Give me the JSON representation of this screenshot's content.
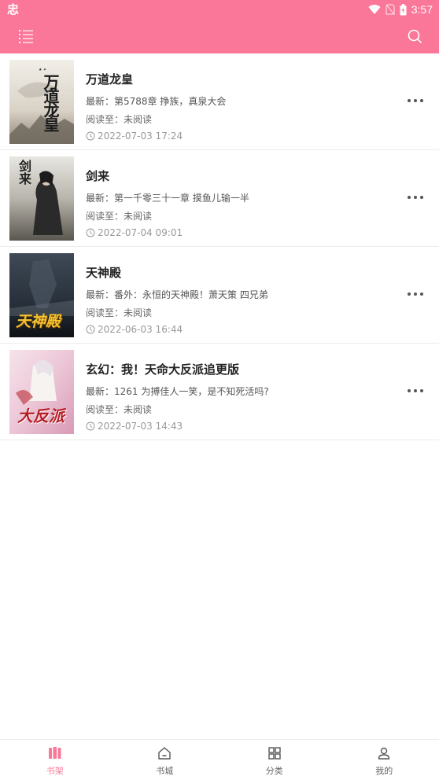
{
  "status_bar": {
    "app_glyph": "忠",
    "time": "3:57",
    "icons": [
      "wifi-icon",
      "signal-no-sim-icon",
      "battery-icon"
    ]
  },
  "toolbar": {
    "menu_icon": "list-menu-icon",
    "search_icon": "search-icon",
    "background": "#fb7799"
  },
  "books": [
    {
      "title": "万道龙皇",
      "cover_text": "万道龙皇",
      "latest": "最新：第5788章 挣族，真泉大会",
      "read_progress": "阅读至：未阅读",
      "updated": "2022-07-03 17:24"
    },
    {
      "title": "剑来",
      "cover_text": "剑来",
      "latest": "最新：第一千零三十一章 摸鱼儿输一半",
      "read_progress": "阅读至：未阅读",
      "updated": "2022-07-04 09:01"
    },
    {
      "title": "天神殿",
      "cover_text": "天神殿",
      "latest": "最新：番外：永恒的天神殿！萧天策 四兄弟",
      "read_progress": "阅读至：未阅读",
      "updated": "2022-06-03 16:44"
    },
    {
      "title": "玄幻：我！天命大反派追更版",
      "cover_text": "大反派",
      "latest": "最新：1261 为搏佳人一笑，是不知死活吗?",
      "read_progress": "阅读至：未阅读",
      "updated": "2022-07-03 14:43"
    }
  ],
  "tabs": [
    {
      "label": "书架",
      "icon": "bookshelf-icon",
      "active": true
    },
    {
      "label": "书城",
      "icon": "home-icon",
      "active": false
    },
    {
      "label": "分类",
      "icon": "category-grid-icon",
      "active": false
    },
    {
      "label": "我的",
      "icon": "user-icon",
      "active": false
    }
  ],
  "colors": {
    "accent": "#fb7799",
    "tab_inactive": "#666666",
    "meta_text": "#999999"
  }
}
